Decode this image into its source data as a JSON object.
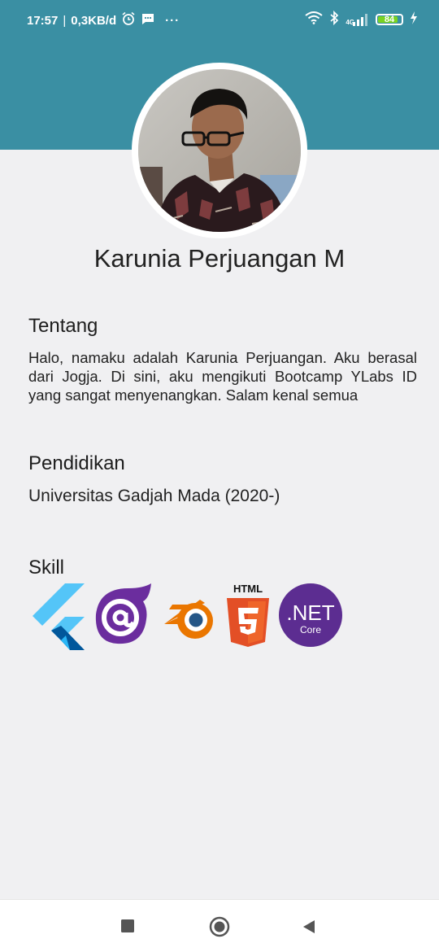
{
  "status_bar": {
    "time": "17:57",
    "separator": "|",
    "speed": "0,3KB/d",
    "more": "···",
    "network": "4G",
    "battery_level": "84",
    "battery_fraction": 0.84,
    "icons": [
      "alarm-icon",
      "message-icon",
      "wifi-icon",
      "bluetooth-icon",
      "signal-icon",
      "battery-icon",
      "charging-icon"
    ]
  },
  "profile": {
    "name": "Karunia Perjuangan M",
    "avatar": "profile-photo"
  },
  "about": {
    "title": "Tentang",
    "text": "Halo, namaku adalah Karunia Perjuangan. Aku berasal dari Jogja. Di sini, aku mengikuti Bootcamp YLabs ID yang sangat menyenangkan. Salam kenal semua"
  },
  "education": {
    "title": "Pendidikan",
    "text": "Universitas Gadjah Mada (2020-)"
  },
  "skills": {
    "title": "Skill",
    "items": [
      {
        "name": "flutter",
        "icon": "flutter-logo"
      },
      {
        "name": "blazor",
        "icon": "blazor-logo"
      },
      {
        "name": "blender",
        "icon": "blender-logo"
      },
      {
        "name": "html5",
        "icon": "html5-logo",
        "label": "HTML",
        "number": "5"
      },
      {
        "name": "dotnet-core",
        "icon": "dotnet-core-logo",
        "label": ".NET",
        "sub": "Core"
      }
    ]
  },
  "nav": [
    "recent-apps",
    "home",
    "back"
  ],
  "colors": {
    "header": "#3a8fa3",
    "background": "#f0f0f2",
    "battery": "#7ad321"
  }
}
